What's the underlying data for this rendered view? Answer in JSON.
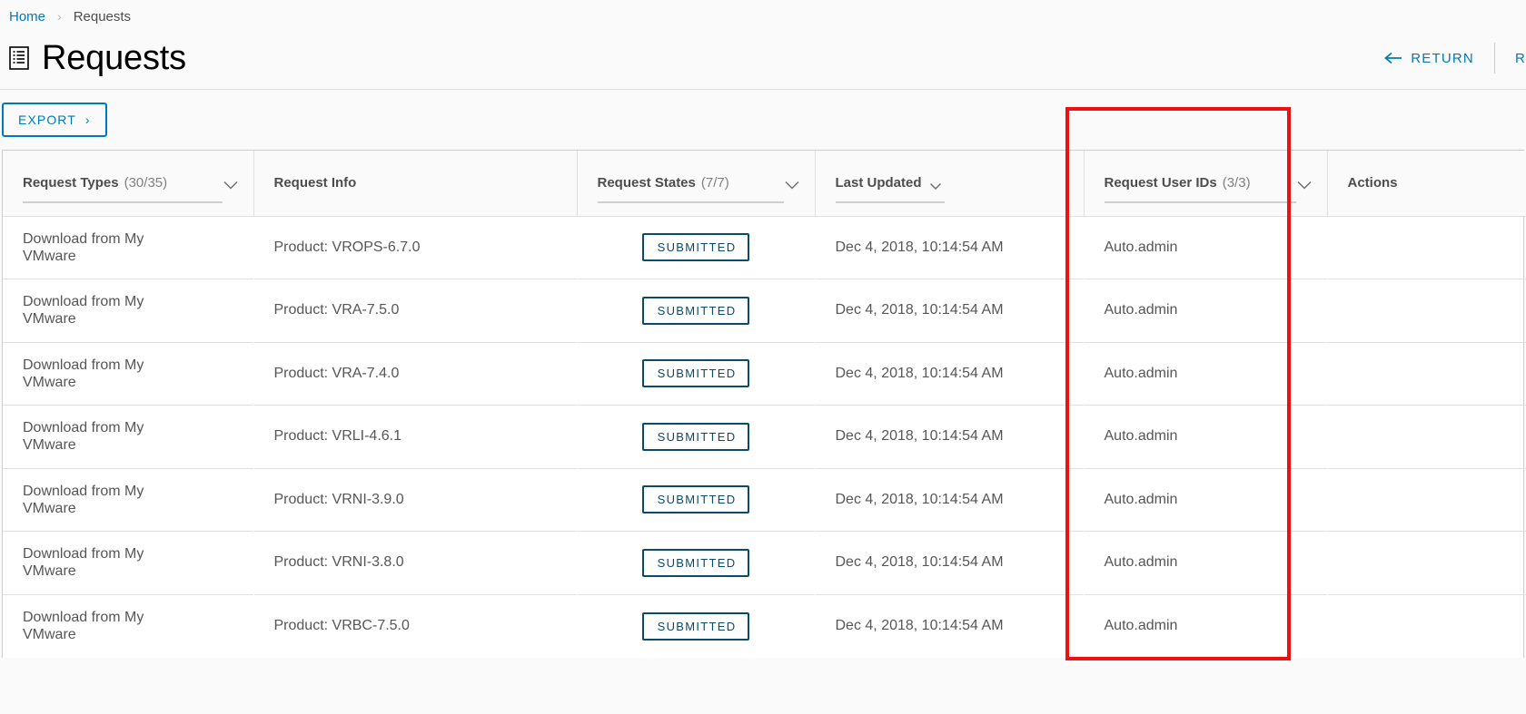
{
  "breadcrumb": {
    "home": "Home",
    "separator": "›",
    "current": "Requests"
  },
  "header": {
    "title": "Requests",
    "title_icon": "list-document-icon",
    "actions": [
      {
        "label": "RETURN",
        "icon": "arrow-left-icon"
      },
      {
        "label": "R",
        "icon": ""
      }
    ]
  },
  "toolbar": {
    "export_label": "EXPORT",
    "export_chevron": "›"
  },
  "table": {
    "columns": [
      {
        "key": "type",
        "label": "Request Types",
        "count": "(30/35)",
        "filterable": true,
        "chevron": true,
        "inline_chevron": false
      },
      {
        "key": "info",
        "label": "Request Info",
        "count": "",
        "filterable": false,
        "chevron": false,
        "inline_chevron": false
      },
      {
        "key": "state",
        "label": "Request States",
        "count": "(7/7)",
        "filterable": true,
        "chevron": true,
        "inline_chevron": false
      },
      {
        "key": "updated",
        "label": "Last Updated",
        "count": "",
        "filterable": true,
        "chevron": false,
        "inline_chevron": true
      },
      {
        "key": "user",
        "label": "Request User IDs",
        "count": "(3/3)",
        "filterable": true,
        "chevron": true,
        "inline_chevron": false
      },
      {
        "key": "actions",
        "label": "Actions",
        "count": "",
        "filterable": false,
        "chevron": false,
        "inline_chevron": false
      }
    ],
    "rows": [
      {
        "type": "Download from My VMware",
        "info": "Product: VROPS-6.7.0",
        "state": "SUBMITTED",
        "updated": "Dec 4, 2018, 10:14:54 AM",
        "user": "Auto.admin",
        "actions": ""
      },
      {
        "type": "Download from My VMware",
        "info": "Product: VRA-7.5.0",
        "state": "SUBMITTED",
        "updated": "Dec 4, 2018, 10:14:54 AM",
        "user": "Auto.admin",
        "actions": ""
      },
      {
        "type": "Download from My VMware",
        "info": "Product: VRA-7.4.0",
        "state": "SUBMITTED",
        "updated": "Dec 4, 2018, 10:14:54 AM",
        "user": "Auto.admin",
        "actions": ""
      },
      {
        "type": "Download from My VMware",
        "info": "Product: VRLI-4.6.1",
        "state": "SUBMITTED",
        "updated": "Dec 4, 2018, 10:14:54 AM",
        "user": "Auto.admin",
        "actions": ""
      },
      {
        "type": "Download from My VMware",
        "info": "Product: VRNI-3.9.0",
        "state": "SUBMITTED",
        "updated": "Dec 4, 2018, 10:14:54 AM",
        "user": "Auto.admin",
        "actions": ""
      },
      {
        "type": "Download from My VMware",
        "info": "Product: VRNI-3.8.0",
        "state": "SUBMITTED",
        "updated": "Dec 4, 2018, 10:14:54 AM",
        "user": "Auto.admin",
        "actions": ""
      },
      {
        "type": "Download from My VMware",
        "info": "Product: VRBC-7.5.0",
        "state": "SUBMITTED",
        "updated": "Dec 4, 2018, 10:14:54 AM",
        "user": "Auto.admin",
        "actions": ""
      }
    ]
  },
  "annotation": {
    "color": "#ee1111",
    "target_column": "Request User IDs"
  },
  "colors": {
    "link": "#0079b8",
    "badge": "#0a4a6b",
    "text": "#565656",
    "heading": "#4d4d4d",
    "page_bg": "#fafafa",
    "annotation": "#ee1111"
  }
}
